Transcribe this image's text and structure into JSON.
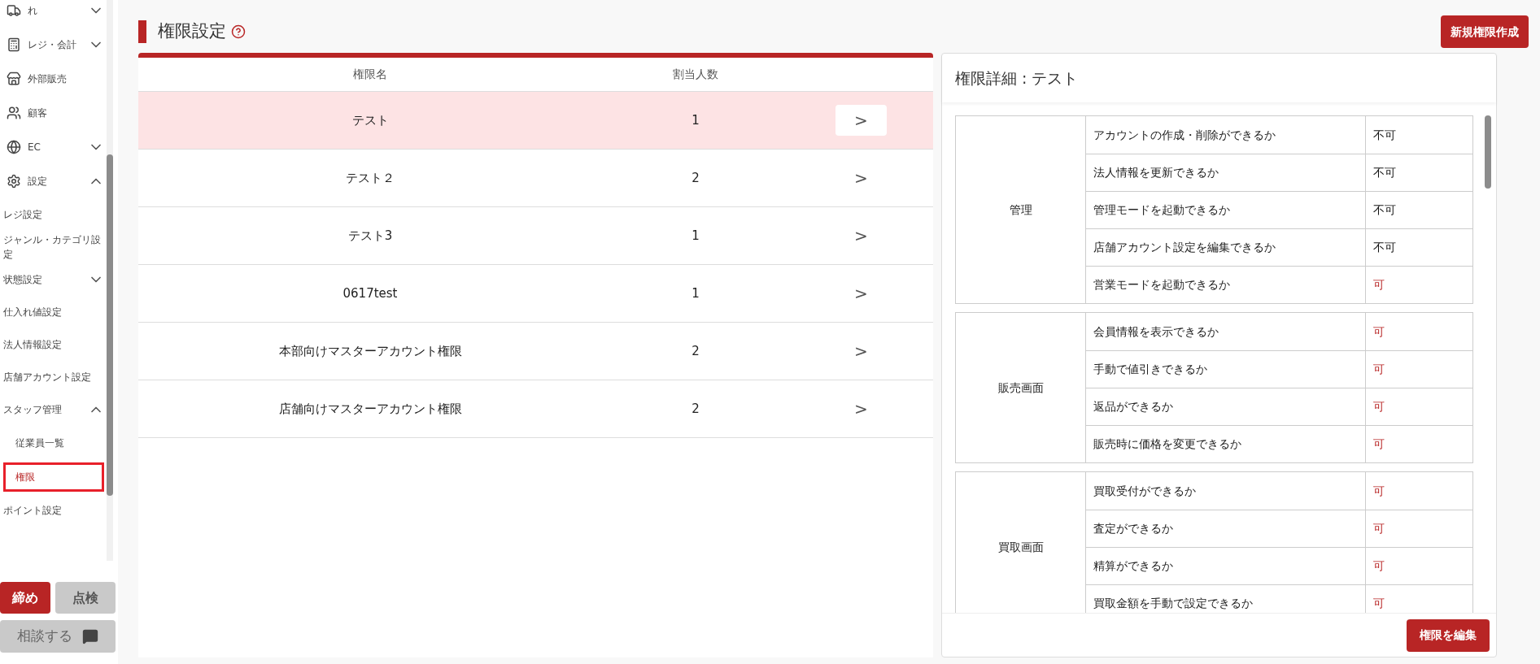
{
  "sidebar": {
    "items": [
      {
        "label": "れ",
        "expanded": false
      },
      {
        "label": "レジ・会計",
        "expanded": false
      },
      {
        "label": "外部販売"
      },
      {
        "label": "顧客"
      },
      {
        "label": "EC",
        "expanded": false
      },
      {
        "label": "設定",
        "expanded": true,
        "children": [
          {
            "label": "レジ設定"
          },
          {
            "label": "ジャンル・カテゴリ設定"
          },
          {
            "label": "状態設定",
            "expanded": false
          },
          {
            "label": "仕入れ値設定"
          },
          {
            "label": "法人情報設定"
          },
          {
            "label": "店舗アカウント設定"
          },
          {
            "label": "スタッフ管理",
            "expanded": true,
            "children": [
              {
                "label": "従業員一覧",
                "selected": false
              },
              {
                "label": "権限",
                "selected": true
              }
            ]
          },
          {
            "label": "ポイント設定"
          }
        ]
      }
    ],
    "buttons": [
      {
        "label": "締め",
        "kind": "primary"
      },
      {
        "label": "点検",
        "kind": "secondary"
      }
    ],
    "consult_button": "相談する"
  },
  "page": {
    "title": "権限設定",
    "new_button": "新規権限作成"
  },
  "table": {
    "columns": [
      "権限名",
      "割当人数"
    ],
    "rows": [
      {
        "name": "テスト",
        "count": "1",
        "arrow": ">",
        "selected": true
      },
      {
        "name": "テスト２",
        "count": "2",
        "arrow": ">",
        "selected": false
      },
      {
        "name": "テスト3",
        "count": "1",
        "arrow": ">",
        "selected": false
      },
      {
        "name": "0617test",
        "count": "1",
        "arrow": ">",
        "selected": false
      },
      {
        "name": "本部向けマスターアカウント権限",
        "count": "2",
        "arrow": ">",
        "selected": false
      },
      {
        "name": "店舗向けマスターアカウント権限",
        "count": "2",
        "arrow": ">",
        "selected": false
      }
    ]
  },
  "detail": {
    "title": "権限詳細 : テスト",
    "edit_button": "権限を編集",
    "groups": [
      {
        "name": "管理",
        "permissions": [
          {
            "label": "アカウントの作成・削除ができるか",
            "value": "不可",
            "allowed": false
          },
          {
            "label": "法人情報を更新できるか",
            "value": "不可",
            "allowed": false
          },
          {
            "label": "管理モードを起動できるか",
            "value": "不可",
            "allowed": false
          },
          {
            "label": "店舗アカウント設定を編集できるか",
            "value": "不可",
            "allowed": false
          },
          {
            "label": "営業モードを起動できるか",
            "value": "可",
            "allowed": true
          }
        ]
      },
      {
        "name": "販売画面",
        "permissions": [
          {
            "label": "会員情報を表示できるか",
            "value": "可",
            "allowed": true
          },
          {
            "label": "手動で値引きできるか",
            "value": "可",
            "allowed": true
          },
          {
            "label": "返品ができるか",
            "value": "可",
            "allowed": true
          },
          {
            "label": "販売時に価格を変更できるか",
            "value": "可",
            "allowed": true
          }
        ]
      },
      {
        "name": "買取画面",
        "permissions": [
          {
            "label": "買取受付ができるか",
            "value": "可",
            "allowed": true
          },
          {
            "label": "査定ができるか",
            "value": "可",
            "allowed": true
          },
          {
            "label": "精算ができるか",
            "value": "可",
            "allowed": true
          },
          {
            "label": "買取金額を手動で設定できるか",
            "value": "可",
            "allowed": true
          }
        ]
      }
    ]
  }
}
